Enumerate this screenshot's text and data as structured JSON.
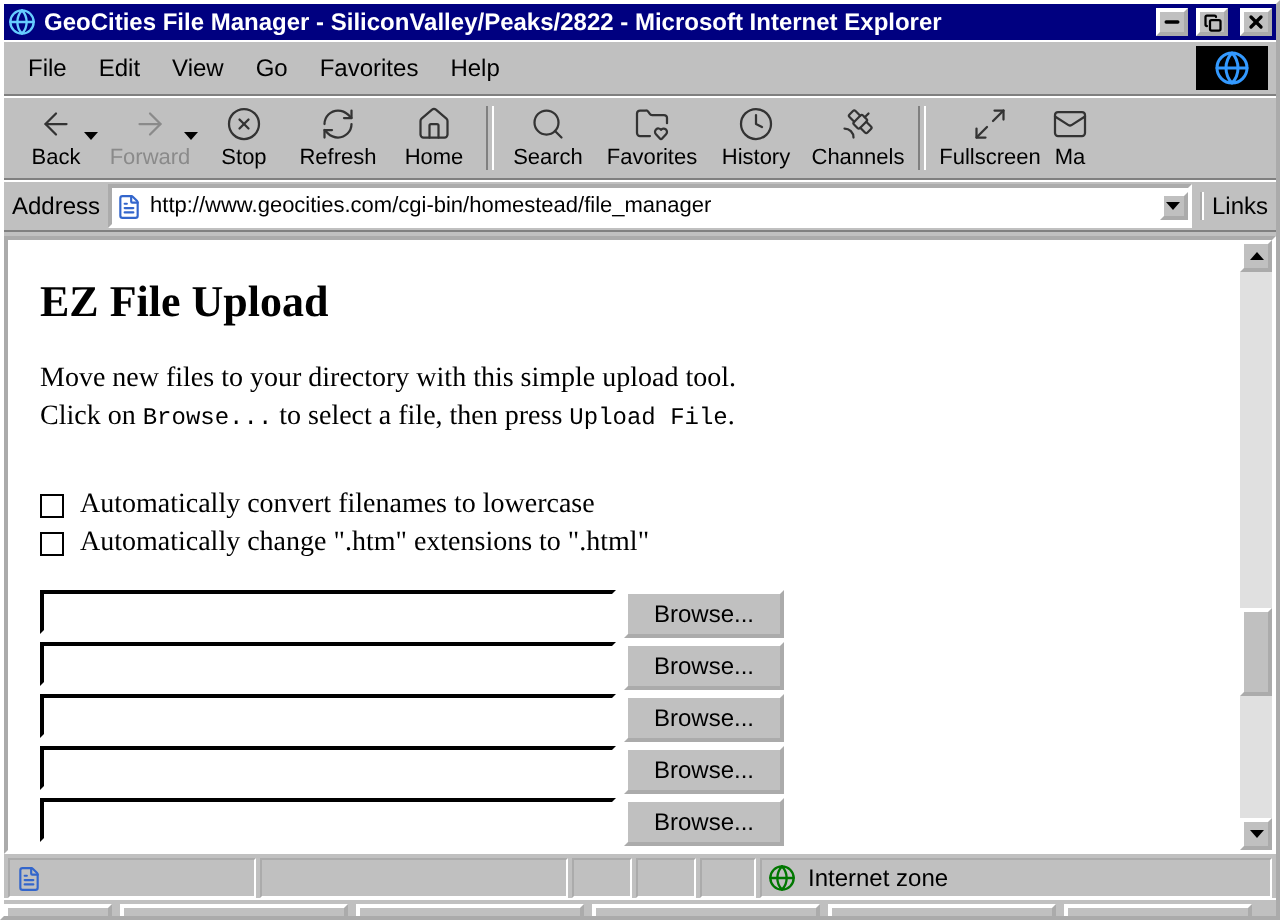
{
  "window": {
    "title": "GeoCities File Manager - SiliconValley/Peaks/2822 - Microsoft Internet Explorer"
  },
  "menu": [
    "File",
    "Edit",
    "View",
    "Go",
    "Favorites",
    "Help"
  ],
  "toolbar": [
    {
      "kind": "back",
      "label": "Back",
      "disabled": false,
      "dropdown": true
    },
    {
      "kind": "forward",
      "label": "Forward",
      "disabled": true,
      "dropdown": true
    },
    {
      "kind": "stop",
      "label": "Stop",
      "disabled": false,
      "dropdown": false
    },
    {
      "kind": "refresh",
      "label": "Refresh",
      "disabled": false,
      "dropdown": false
    },
    {
      "kind": "home",
      "label": "Home",
      "disabled": false,
      "dropdown": false
    },
    {
      "kind": "search",
      "label": "Search",
      "disabled": false,
      "dropdown": false
    },
    {
      "kind": "favorites",
      "label": "Favorites",
      "disabled": false,
      "dropdown": false
    },
    {
      "kind": "history",
      "label": "History",
      "disabled": false,
      "dropdown": false
    },
    {
      "kind": "channels",
      "label": "Channels",
      "disabled": false,
      "dropdown": false
    },
    {
      "kind": "fullscreen",
      "label": "Fullscreen",
      "disabled": false,
      "dropdown": false
    },
    {
      "kind": "mail",
      "label": "Ma",
      "disabled": false,
      "dropdown": false
    }
  ],
  "address": {
    "label": "Address",
    "value": "http://www.geocities.com/cgi-bin/homestead/file_manager",
    "links": "Links"
  },
  "page": {
    "heading": "EZ File Upload",
    "intro": [
      [
        {
          "text": "Move new files to your directory with this simple upload tool.",
          "code": false
        }
      ],
      [
        {
          "text": "Click on ",
          "code": false
        },
        {
          "text": "Browse...",
          "code": true
        },
        {
          "text": " to select a file, then press ",
          "code": false
        },
        {
          "text": "Upload File",
          "code": true
        },
        {
          "text": ".",
          "code": false
        }
      ]
    ],
    "options": [
      {
        "label": "Automatically convert filenames to lowercase",
        "checked": false
      },
      {
        "label": "Automatically change \".htm\" extensions to \".html\"",
        "checked": false
      }
    ],
    "uploads": [
      {
        "button": "Browse..."
      },
      {
        "button": "Browse..."
      },
      {
        "button": "Browse..."
      },
      {
        "button": "Browse..."
      },
      {
        "button": "Browse..."
      }
    ]
  },
  "status_bar": {
    "zone": "Internet zone"
  }
}
